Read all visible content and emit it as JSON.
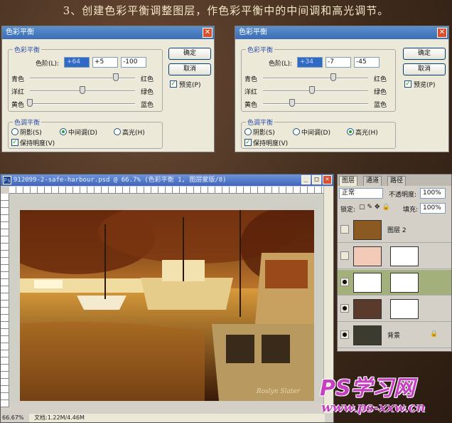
{
  "heading": "3、创建色彩平衡调整图层，作色彩平衡中的中间调和高光调节。",
  "dialogs": [
    {
      "title": "色彩平衡",
      "group_balance": "色彩平衡",
      "levels_label": "色阶(L):",
      "levels": [
        "+64",
        "+5",
        "-100"
      ],
      "slider_rows": [
        {
          "left": "青色",
          "right": "红色",
          "level": 0.82
        },
        {
          "left": "洋红",
          "right": "绿色",
          "level": 0.5
        },
        {
          "left": "黄色",
          "right": "蓝色",
          "level": 0.0
        }
      ],
      "group_tone": "色调平衡",
      "tones": [
        "阴影(S)",
        "中间调(D)",
        "高光(H)"
      ],
      "tone_selected": 1,
      "preserve": "保持明度(V)",
      "ok": "确定",
      "cancel": "取消",
      "preview": "预览(P)"
    },
    {
      "title": "色彩平衡",
      "group_balance": "色彩平衡",
      "levels_label": "色阶(L):",
      "levels": [
        "+34",
        "-7",
        "-45"
      ],
      "slider_rows": [
        {
          "left": "青色",
          "right": "红色",
          "level": 0.67
        },
        {
          "left": "洋红",
          "right": "绿色",
          "level": 0.465
        },
        {
          "left": "黄色",
          "right": "蓝色",
          "level": 0.275
        }
      ],
      "group_tone": "色调平衡",
      "tones": [
        "阴影(S)",
        "中间调(D)",
        "高光(H)"
      ],
      "tone_selected": 2,
      "preserve": "保持明度(V)",
      "ok": "确定",
      "cancel": "取消",
      "preview": "预览(P)"
    }
  ],
  "document": {
    "title": "912099-2-safe-harbour.psd @ 66.7% (色彩平衡 1, 图层蒙版/8)",
    "zoom_status": "66.67%",
    "doc_status": "文档:1.22M/4.46M",
    "photo_signature": "Roslyn Slater"
  },
  "layers_panel": {
    "tabs": [
      "图层",
      "通道",
      "路径"
    ],
    "blend_mode": "正常",
    "opacity_label": "不透明度:",
    "opacity": "100%",
    "lock_label": "锁定:",
    "fill_label": "填充:",
    "fill": "100%",
    "layers": [
      {
        "name": "图层 2",
        "visible": false,
        "thumb": "#8a5a22"
      },
      {
        "name": "",
        "visible": false,
        "thumb": "#f3c9b8"
      },
      {
        "name": "",
        "visible": true,
        "thumb": "#ffffff",
        "active": true
      },
      {
        "name": "",
        "visible": true,
        "thumb": "#5a3a2a"
      },
      {
        "name": "背景",
        "visible": true,
        "thumb": "#3b3b30",
        "locked": true
      }
    ]
  },
  "watermark": {
    "logo": "PS学习网",
    "url": "www.ps-xxw.cn"
  }
}
